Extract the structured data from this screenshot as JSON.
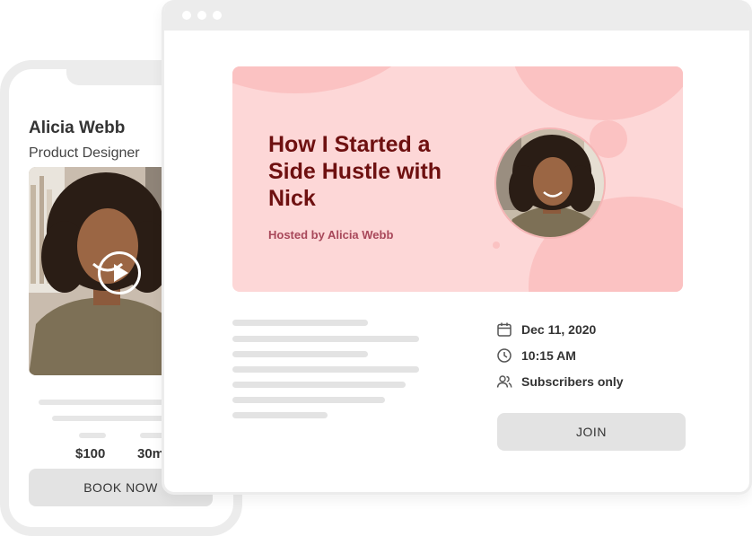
{
  "phone": {
    "host_name": "Alicia Webb",
    "host_role": "Product Designer",
    "price": "$100",
    "duration": "30m",
    "book_label": "BOOK NOW",
    "play_icon": "play-icon"
  },
  "browser": {
    "event": {
      "title": "How I Started a Side Hustle with Nick",
      "hosted_by": "Hosted by Alicia Webb",
      "date": "Dec 11, 2020",
      "time": "10:15 AM",
      "audience": "Subscribers only",
      "join_label": "JOIN"
    },
    "icons": {
      "date": "calendar-icon",
      "time": "clock-icon",
      "audience": "users-icon"
    }
  },
  "colors": {
    "banner_bg": "#fdd7d7",
    "banner_blob": "#fbc2c2",
    "title_text": "#6e1010",
    "host_text": "#a8485a",
    "button_bg": "#e3e3e3",
    "frame": "#ececec"
  }
}
